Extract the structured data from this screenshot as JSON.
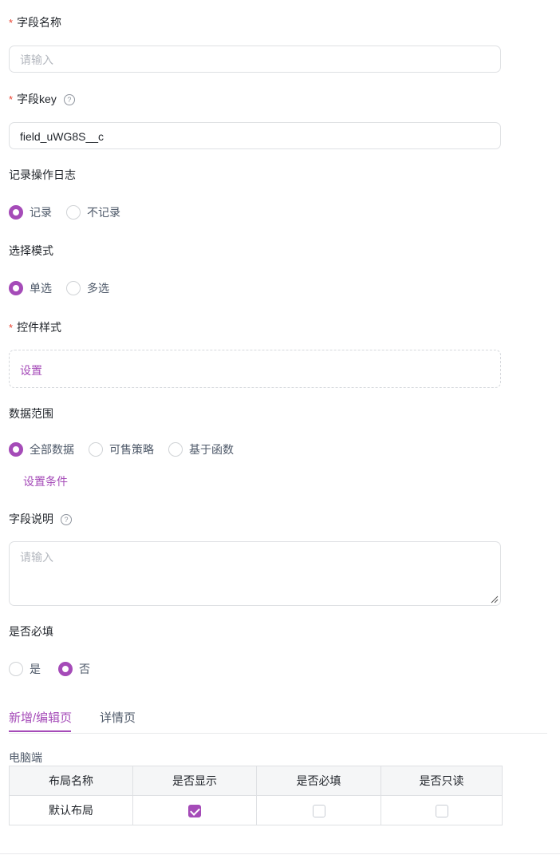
{
  "field_name": {
    "label": "字段名称",
    "required_mark": "*",
    "placeholder": "请输入"
  },
  "field_key": {
    "label": "字段key",
    "required_mark": "*",
    "help": "?",
    "value": "field_uWG8S__c"
  },
  "operation_log": {
    "label": "记录操作日志",
    "options": [
      {
        "label": "记录",
        "checked": true
      },
      {
        "label": "不记录",
        "checked": false
      }
    ]
  },
  "select_mode": {
    "label": "选择模式",
    "options": [
      {
        "label": "单选",
        "checked": true
      },
      {
        "label": "多选",
        "checked": false
      }
    ]
  },
  "control_style": {
    "label": "控件样式",
    "required_mark": "*",
    "setting_link": "设置"
  },
  "data_range": {
    "label": "数据范围",
    "options": [
      {
        "label": "全部数据",
        "checked": true
      },
      {
        "label": "可售策略",
        "checked": false
      },
      {
        "label": "基于函数",
        "checked": false
      }
    ],
    "condition_link": "设置条件"
  },
  "field_desc": {
    "label": "字段说明",
    "help": "?",
    "placeholder": "请输入"
  },
  "required_field": {
    "label": "是否必填",
    "options": [
      {
        "label": "是",
        "checked": false
      },
      {
        "label": "否",
        "checked": true
      }
    ]
  },
  "tabs": [
    {
      "label": "新增/编辑页",
      "active": true
    },
    {
      "label": "详情页",
      "active": false
    }
  ],
  "layout_table": {
    "section_title": "电脑端",
    "headers": [
      "布局名称",
      "是否显示",
      "是否必填",
      "是否只读"
    ],
    "rows": [
      {
        "name": "默认布局",
        "show": true,
        "required": false,
        "readonly": false
      }
    ]
  },
  "colors": {
    "accent": "#a54bb8",
    "required": "#e8412f",
    "border": "#dee0e3"
  }
}
